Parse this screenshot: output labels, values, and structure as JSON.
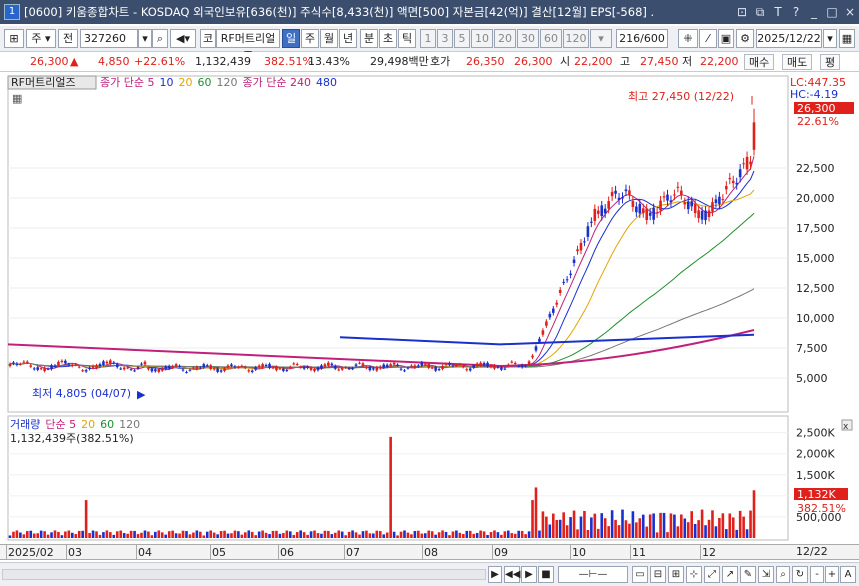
{
  "window": {
    "icon": "1",
    "title": "[0600] 키움종합차트 - KOSDAQ 외국인보유[636(천)] 주식수[8,433(천)] 액면[500] 자본금[42(억)] 결산[12월] EPS[-568] .",
    "controls": [
      "⊡",
      "⧉",
      "T",
      "?",
      "_",
      "□",
      "×"
    ]
  },
  "toolbar": {
    "market": "주",
    "market_alt": "전",
    "code": "327260",
    "search_icon": "search-icon",
    "type_label": "코",
    "stock_name": "RF머트리얼즈",
    "periods": [
      "일",
      "주",
      "월",
      "년",
      "분",
      "초",
      "틱"
    ],
    "active_period": "일",
    "intervals": [
      "1",
      "3",
      "5",
      "10",
      "20",
      "30",
      "60",
      "120"
    ],
    "count_value": "216",
    "count_total": "/600",
    "date": "2025/12/22"
  },
  "quote": {
    "price": "26,300",
    "arrow": "▲",
    "change": "4,850",
    "change_pct": "+22.61%",
    "volume": "1,132,439",
    "vol_ratio": "382.51%",
    "turnover": "13.43%",
    "amount": "29,498백만",
    "ask_label": "호가",
    "ask1": "26,350",
    "ask2": "26,300",
    "open_label": "시",
    "open": "22,200",
    "high_label": "고",
    "high": "27,450",
    "low_label": "저",
    "low": "22,200",
    "buy": "매수",
    "sell": "매도",
    "eval": "평"
  },
  "price_panel": {
    "tag": "RF머트리얼즈",
    "legend": [
      {
        "text": "종가 단순 5",
        "color": "#c0207a"
      },
      {
        "text": "10",
        "color": "#1a2fcf"
      },
      {
        "text": "20",
        "color": "#e1a400"
      },
      {
        "text": "60",
        "color": "#1f8f2e"
      },
      {
        "text": "120",
        "color": "#777777"
      },
      {
        "text": "종가 단순 240",
        "color": "#c0207a"
      },
      {
        "text": "480",
        "color": "#1a2fcf"
      }
    ],
    "lc": "LC:447.35",
    "hc": "HC:-4.19",
    "last_price": "26,300",
    "last_pct": "22.61%",
    "high_note": "최고 27,450 (12/22)",
    "low_note": "최저 4,805 (04/07)",
    "y_ticks": [
      "22,500",
      "20,000",
      "17,500",
      "15,000",
      "12,500",
      "10,000",
      "7,500",
      "5,000"
    ]
  },
  "volume_panel": {
    "legend": [
      {
        "text": "거래량",
        "color": "#1a2fcf"
      },
      {
        "text": "단순 5",
        "color": "#c0207a"
      },
      {
        "text": "20",
        "color": "#e1a400"
      },
      {
        "text": "60",
        "color": "#1f8f2e"
      },
      {
        "text": "120",
        "color": "#777777"
      }
    ],
    "summary": "1,132,439주(382.51%)",
    "y_ticks": [
      "2,500K",
      "2,000K",
      "1,500K",
      "1,000K",
      "500,000"
    ],
    "last_value": "1,132K",
    "last_pct": "382.51%"
  },
  "x_axis": {
    "months": [
      "2025/02",
      "03",
      "04",
      "05",
      "06",
      "07",
      "08",
      "09",
      "10",
      "11",
      "12"
    ],
    "end_label": "12/22"
  },
  "chart_data": {
    "type": "candlestick",
    "y_ticks": [
      5000,
      7500,
      10000,
      12500,
      15000,
      17500,
      20000,
      22500
    ],
    "last_close": 26300,
    "period_high": {
      "value": 27450,
      "date": "12/22"
    },
    "period_low": {
      "value": 4805,
      "date": "04/07"
    },
    "ma240_level": 7400,
    "ma480_level": 8600,
    "last_volume": 1132439,
    "volume_y_ticks": [
      500000,
      1000000,
      1500000,
      2000000,
      2500000
    ]
  },
  "bottom": {
    "nav_buttons": [
      "◀",
      "▶",
      "◀◀",
      "▶",
      "■"
    ],
    "zoom_buttons": [
      "-",
      "+",
      "A"
    ]
  }
}
